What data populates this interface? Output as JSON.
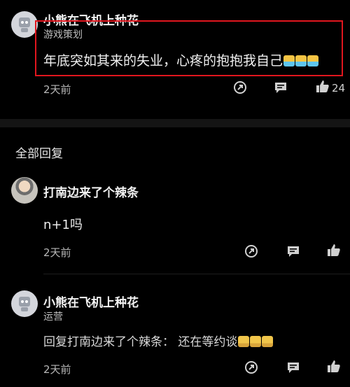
{
  "top_comment": {
    "username": "小熊在飞机上种花",
    "role": "游戏策划",
    "content": "年底突如其来的失业，心疼的抱抱我自己",
    "emoji_count": 3,
    "time": "2天前",
    "like_count": "24"
  },
  "replies_section": {
    "title": "全部回复"
  },
  "replies": [
    {
      "username": "打南边来了个辣条",
      "content": "n+1吗",
      "time": "2天前"
    },
    {
      "username": "小熊在飞机上种花",
      "role": "运营",
      "content": "回复打南边来了个辣条：  还在等约谈",
      "emoji_count": 3,
      "time": "2天前"
    }
  ],
  "icons": [
    "share-icon",
    "comment-icon",
    "like-icon"
  ],
  "colors": {
    "highlight_border": "#e0161e",
    "background": "#000000"
  }
}
